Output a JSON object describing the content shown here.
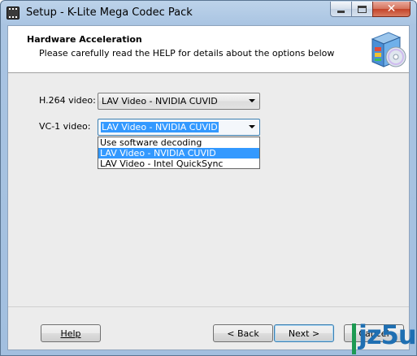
{
  "window": {
    "title": "Setup - K-Lite Mega Codec Pack"
  },
  "header": {
    "title": "Hardware Acceleration",
    "subtitle": "Please carefully read the HELP for details about the options below"
  },
  "fields": {
    "h264": {
      "label": "H.264 video:",
      "value": "LAV Video - NVIDIA CUVID"
    },
    "vc1": {
      "label": "VC-1 video:",
      "value": "LAV Video - NVIDIA CUVID",
      "options": [
        "Use software decoding",
        "LAV Video - NVIDIA CUVID",
        "LAV Video - Intel QuickSync"
      ],
      "selected_index": 1
    }
  },
  "buttons": {
    "help": "Help",
    "back": "< Back",
    "next": "Next >",
    "cancel": "Cancel"
  },
  "watermark": {
    "text": "jz5u"
  },
  "icons": {
    "app": "film-clapper-icon",
    "header": "codec-box-cd-icon"
  }
}
